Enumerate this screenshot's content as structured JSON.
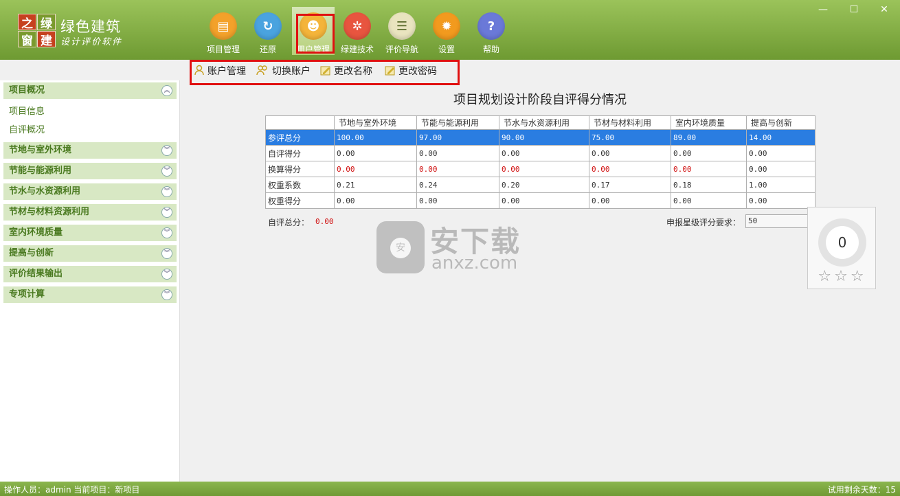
{
  "app": {
    "logo_chars": [
      "之",
      "绿",
      "窗",
      "建"
    ],
    "title": "绿色建筑",
    "subtitle": "设计评价软件"
  },
  "toolbar": [
    {
      "label": "项目管理",
      "icon": "folder-icon",
      "color": "#f3a12a"
    },
    {
      "label": "还原",
      "icon": "refresh-icon",
      "color": "#4aa3df"
    },
    {
      "label": "用户管理",
      "icon": "user-icon",
      "color": "#f4b43a"
    },
    {
      "label": "绿建技术",
      "icon": "network-icon",
      "color": "#e8553f"
    },
    {
      "label": "评价导航",
      "icon": "book-icon",
      "color": "#e9e4bf"
    },
    {
      "label": "设置",
      "icon": "gear-icon",
      "color": "#f29a1e"
    },
    {
      "label": "帮助",
      "icon": "help-icon",
      "color": "#6a79d8"
    }
  ],
  "window_controls": {
    "minimize": "—",
    "maximize": "☐",
    "close": "✕"
  },
  "sub_toolbar": [
    {
      "label": "账户管理",
      "icon": "account-icon"
    },
    {
      "label": "切换账户",
      "icon": "switch-account-icon"
    },
    {
      "label": "更改名称",
      "icon": "edit-name-icon"
    },
    {
      "label": "更改密码",
      "icon": "edit-password-icon"
    }
  ],
  "sidebar": {
    "sections": [
      {
        "label": "项目概况",
        "expanded": true,
        "items": [
          "项目信息",
          "自评概况"
        ]
      },
      {
        "label": "节地与室外环境",
        "expanded": false
      },
      {
        "label": "节能与能源利用",
        "expanded": false
      },
      {
        "label": "节水与水资源利用",
        "expanded": false
      },
      {
        "label": "节材与材料资源利用",
        "expanded": false
      },
      {
        "label": "室内环境质量",
        "expanded": false
      },
      {
        "label": "提高与创新",
        "expanded": false
      },
      {
        "label": "评价结果输出",
        "expanded": false
      },
      {
        "label": "专项计算",
        "expanded": false
      }
    ]
  },
  "report": {
    "title": "项目规划设计阶段自评得分情况",
    "columns": [
      "",
      "节地与室外环境",
      "节能与能源利用",
      "节水与水资源利用",
      "节材与材料利用",
      "室内环境质量",
      "提高与创新"
    ],
    "rows": [
      {
        "label": "参评总分",
        "values": [
          "100.00",
          "97.00",
          "90.00",
          "75.00",
          "89.00",
          "14.00"
        ]
      },
      {
        "label": "自评得分",
        "values": [
          "0.00",
          "0.00",
          "0.00",
          "0.00",
          "0.00",
          "0.00"
        ]
      },
      {
        "label": "换算得分",
        "values": [
          "0.00",
          "0.00",
          "0.00",
          "0.00",
          "0.00",
          "0.00"
        ]
      },
      {
        "label": "权重系数",
        "values": [
          "0.21",
          "0.24",
          "0.20",
          "0.17",
          "0.18",
          "1.00"
        ]
      },
      {
        "label": "权重得分",
        "values": [
          "0.00",
          "0.00",
          "0.00",
          "0.00",
          "0.00",
          "0.00"
        ]
      }
    ],
    "self_total_label": "自评总分：",
    "self_total_value": "0.00",
    "star_requirement_label": "申报星级评分要求：",
    "star_requirement_value": "50",
    "score": "0",
    "stars": "☆☆☆"
  },
  "watermark": {
    "text_cn": "安下载",
    "text_en": "anxz.com",
    "shield_char": "安"
  },
  "status": {
    "left": "操作人员：admin  当前项目：新项目",
    "right": "试用剩余天数：15"
  }
}
